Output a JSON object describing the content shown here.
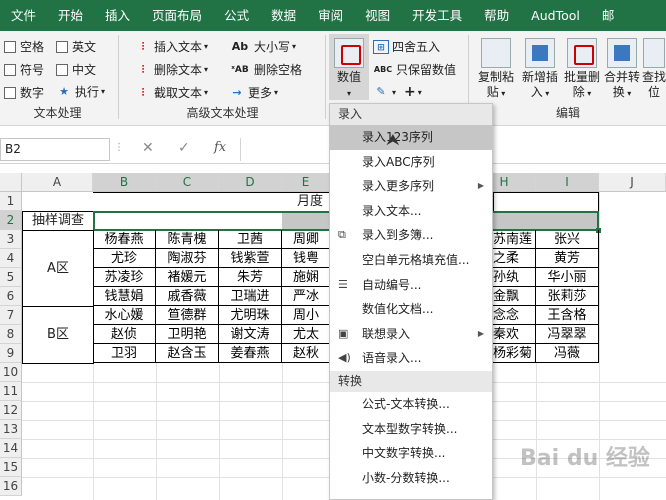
{
  "tabs": [
    "文件",
    "开始",
    "插入",
    "页面布局",
    "公式",
    "数据",
    "审阅",
    "视图",
    "开发工具",
    "帮助",
    "AudTool",
    "邮"
  ],
  "ribbon": {
    "text_processing": {
      "checkboxes": [
        {
          "label": "空格"
        },
        {
          "label": "英文"
        },
        {
          "label": "符号"
        },
        {
          "label": "中文"
        },
        {
          "label": "数字"
        },
        {
          "label": "执行"
        }
      ],
      "label": "文本处理"
    },
    "advanced_text": {
      "buttons": [
        {
          "label": "插入文本",
          "icon": "insert-text-icon"
        },
        {
          "label": "删除文本",
          "icon": "delete-text-icon"
        },
        {
          "label": "截取文本",
          "icon": "extract-text-icon"
        },
        {
          "label": "大小写",
          "icon": "case-icon"
        },
        {
          "label": "删除空格",
          "icon": "remove-space-icon"
        },
        {
          "label": "更多",
          "icon": "more-icon"
        }
      ],
      "label": "高级文本处理"
    },
    "numeric": {
      "big_label": "数值",
      "round_label": "四舍五入",
      "keep_value_label": "只保留数值"
    },
    "edit": {
      "buttons": [
        {
          "line1": "复制粘",
          "line2": "贴"
        },
        {
          "line1": "新增插",
          "line2": "入"
        },
        {
          "line1": "批量删",
          "line2": "除"
        },
        {
          "line1": "合并转",
          "line2": "换"
        },
        {
          "line1": "查找",
          "line2": "位"
        }
      ],
      "label": "编辑"
    }
  },
  "formula_bar": {
    "name_box": "B2",
    "cancel": "✕",
    "confirm": "✓",
    "fx": "fx"
  },
  "columns": [
    "A",
    "B",
    "C",
    "D",
    "E",
    "F",
    "G",
    "H",
    "I",
    "J"
  ],
  "rows": [
    "1",
    "2",
    "3",
    "4",
    "5",
    "6",
    "7",
    "8",
    "9",
    "10",
    "11",
    "12",
    "13",
    "14",
    "15",
    "16"
  ],
  "sheet": {
    "title_partial": "月度",
    "survey_label": "抽样调查",
    "region_a": "A区",
    "region_b": "B区",
    "names_left": [
      [
        "杨春燕",
        "陈青槐",
        "卫茜",
        "周卿"
      ],
      [
        "尤珍",
        "陶淑芬",
        "钱紫萱",
        "钱粤"
      ],
      [
        "苏凌珍",
        "褚媛元",
        "朱芳",
        "施娴"
      ],
      [
        "钱慧娟",
        "戚香薇",
        "卫瑞进",
        "严冰"
      ],
      [
        "水心媛",
        "笪德群",
        "尤明珠",
        "周小"
      ],
      [
        "赵侦",
        "卫明艳",
        "谢文涛",
        "尤太"
      ],
      [
        "卫羽",
        "赵含玉",
        "姜春燕",
        "赵秋"
      ]
    ],
    "names_right": [
      [
        "苏南莲",
        "张兴"
      ],
      [
        "之柔",
        "黄芳"
      ],
      [
        "孙纨",
        "华小丽"
      ],
      [
        "金飘",
        "张莉莎"
      ],
      [
        "念念",
        "王含格"
      ],
      [
        "秦欢",
        "冯翠翠"
      ],
      [
        "杨彩菊",
        "冯薇"
      ]
    ]
  },
  "menu": {
    "section_entry": "录入",
    "items_entry": [
      {
        "label": "录入123序列",
        "active": true,
        "arrow": false
      },
      {
        "label": "录入ABC序列",
        "active": false,
        "arrow": false
      },
      {
        "label": "录入更多序列",
        "active": false,
        "arrow": true
      },
      {
        "label": "录入文本...",
        "active": false,
        "arrow": false
      },
      {
        "label": "录入到多簿...",
        "active": false,
        "arrow": false
      },
      {
        "label": "空白单元格填充值...",
        "active": false,
        "arrow": false
      },
      {
        "label": "自动编号...",
        "active": false,
        "arrow": false
      },
      {
        "label": "数值化文档...",
        "active": false,
        "arrow": false
      },
      {
        "label": "联想录入",
        "active": false,
        "arrow": true
      },
      {
        "label": "语音录入...",
        "active": false,
        "arrow": false
      }
    ],
    "section_convert": "转换",
    "items_convert": [
      {
        "label": "公式-文本转换..."
      },
      {
        "label": "文本型数字转换..."
      },
      {
        "label": "中文数字转换..."
      },
      {
        "label": "小数-分数转换..."
      }
    ]
  },
  "watermark": "Bai du 经验",
  "colors": {
    "excel_green": "#217346",
    "menu_highlight": "#c6c6c6"
  }
}
